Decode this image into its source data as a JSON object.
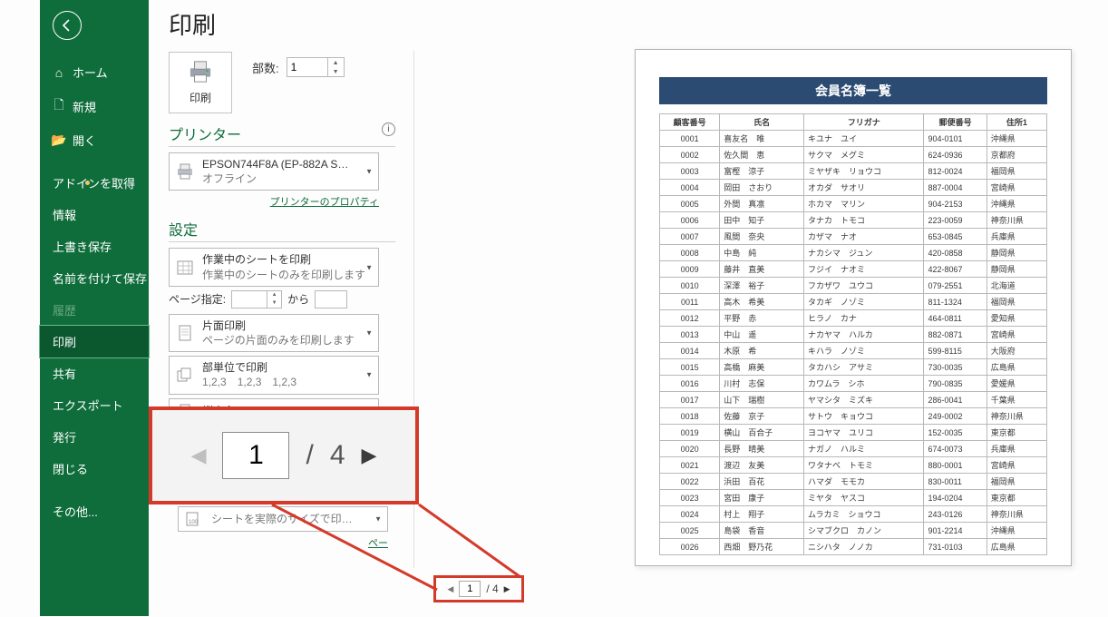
{
  "page_title": "印刷",
  "sidebar": {
    "items": [
      {
        "icon": "home",
        "label": "ホーム"
      },
      {
        "icon": "file",
        "label": "新規"
      },
      {
        "icon": "open",
        "label": "開く"
      },
      {
        "icon": "",
        "label": "アドインを取得",
        "dot": true
      },
      {
        "icon": "",
        "label": "情報"
      },
      {
        "icon": "",
        "label": "上書き保存"
      },
      {
        "icon": "",
        "label": "名前を付けて保存"
      },
      {
        "icon": "",
        "label": "履歴",
        "disabled": true
      },
      {
        "icon": "",
        "label": "印刷",
        "selected": true
      },
      {
        "icon": "",
        "label": "共有"
      },
      {
        "icon": "",
        "label": "エクスポート"
      },
      {
        "icon": "",
        "label": "発行"
      },
      {
        "icon": "",
        "label": "閉じる"
      },
      {
        "icon": "",
        "label": "その他..."
      }
    ]
  },
  "print_button_label": "印刷",
  "copies": {
    "label": "部数:",
    "value": "1"
  },
  "printer_section": "プリンター",
  "printer": {
    "name": "EPSON744F8A (EP-882A S…",
    "status": "オフライン"
  },
  "printer_properties_link": "プリンターのプロパティ",
  "settings_section": "設定",
  "combo_sheet": {
    "title": "作業中のシートを印刷",
    "sub": "作業中のシートのみを印刷します"
  },
  "page_spec": {
    "label": "ページ指定:",
    "from": "",
    "sep": "から",
    "to": ""
  },
  "combo_side": {
    "title": "片面印刷",
    "sub": "ページの片面のみを印刷します"
  },
  "combo_collate": {
    "title": "部単位で印刷",
    "sub": "1,2,3　1,2,3　1,2,3"
  },
  "combo_orient": {
    "title": "縦方向",
    "sub": ""
  },
  "combo_scale": {
    "title": "",
    "sub": "シートを実際のサイズで印…"
  },
  "page_setup_truncated": "ペー",
  "pager": {
    "current": "1",
    "total": "4"
  },
  "preview": {
    "title": "会員名簿一覧",
    "cols": [
      "顧客番号",
      "氏名",
      "フリガナ",
      "郵便番号",
      "住所1"
    ],
    "rows": [
      [
        "0001",
        "喜友名　唯",
        "キユナ　ユイ",
        "904-0101",
        "沖縄県"
      ],
      [
        "0002",
        "佐久間　恵",
        "サクマ　メグミ",
        "624-0936",
        "京都府"
      ],
      [
        "0003",
        "富樫　涼子",
        "ミヤザキ　リョウコ",
        "812-0024",
        "福岡県"
      ],
      [
        "0004",
        "岡田　さおり",
        "オカダ　サオリ",
        "887-0004",
        "宮崎県"
      ],
      [
        "0005",
        "外間　真凛",
        "ホカマ　マリン",
        "904-2153",
        "沖縄県"
      ],
      [
        "0006",
        "田中　知子",
        "タナカ　トモコ",
        "223-0059",
        "神奈川県"
      ],
      [
        "0007",
        "風間　奈央",
        "カザマ　ナオ",
        "653-0845",
        "兵庫県"
      ],
      [
        "0008",
        "中島　純",
        "ナカシマ　ジュン",
        "420-0858",
        "静岡県"
      ],
      [
        "0009",
        "藤井　直美",
        "フジイ　ナオミ",
        "422-8067",
        "静岡県"
      ],
      [
        "0010",
        "深澤　裕子",
        "フカザワ　ユウコ",
        "079-2551",
        "北海道"
      ],
      [
        "0011",
        "高木　希美",
        "タカギ　ノゾミ",
        "811-1324",
        "福岡県"
      ],
      [
        "0012",
        "平野　赤",
        "ヒラノ　カナ",
        "464-0811",
        "愛知県"
      ],
      [
        "0013",
        "中山　遥",
        "ナカヤマ　ハルカ",
        "882-0871",
        "宮崎県"
      ],
      [
        "0014",
        "木原　希",
        "キハラ　ノゾミ",
        "599-8115",
        "大阪府"
      ],
      [
        "0015",
        "高橋　麻美",
        "タカハシ　アサミ",
        "730-0035",
        "広島県"
      ],
      [
        "0016",
        "川村　志保",
        "カワムラ　シホ",
        "790-0835",
        "愛媛県"
      ],
      [
        "0017",
        "山下　瑞樹",
        "ヤマシタ　ミズキ",
        "286-0041",
        "千葉県"
      ],
      [
        "0018",
        "佐藤　京子",
        "サトウ　キョウコ",
        "249-0002",
        "神奈川県"
      ],
      [
        "0019",
        "横山　百合子",
        "ヨコヤマ　ユリコ",
        "152-0035",
        "東京都"
      ],
      [
        "0020",
        "長野　晴美",
        "ナガノ　ハルミ",
        "674-0073",
        "兵庫県"
      ],
      [
        "0021",
        "渡辺　友美",
        "ワタナベ　トモミ",
        "880-0001",
        "宮崎県"
      ],
      [
        "0022",
        "浜田　百花",
        "ハマダ　モモカ",
        "830-0011",
        "福岡県"
      ],
      [
        "0023",
        "宮田　康子",
        "ミヤタ　ヤスコ",
        "194-0204",
        "東京都"
      ],
      [
        "0024",
        "村上　翔子",
        "ムラカミ　ショウコ",
        "243-0126",
        "神奈川県"
      ],
      [
        "0025",
        "島袋　香音",
        "シマブクロ　カノン",
        "901-2214",
        "沖縄県"
      ],
      [
        "0026",
        "西畑　野乃花",
        "ニシハタ　ノノカ",
        "731-0103",
        "広島県"
      ]
    ]
  }
}
